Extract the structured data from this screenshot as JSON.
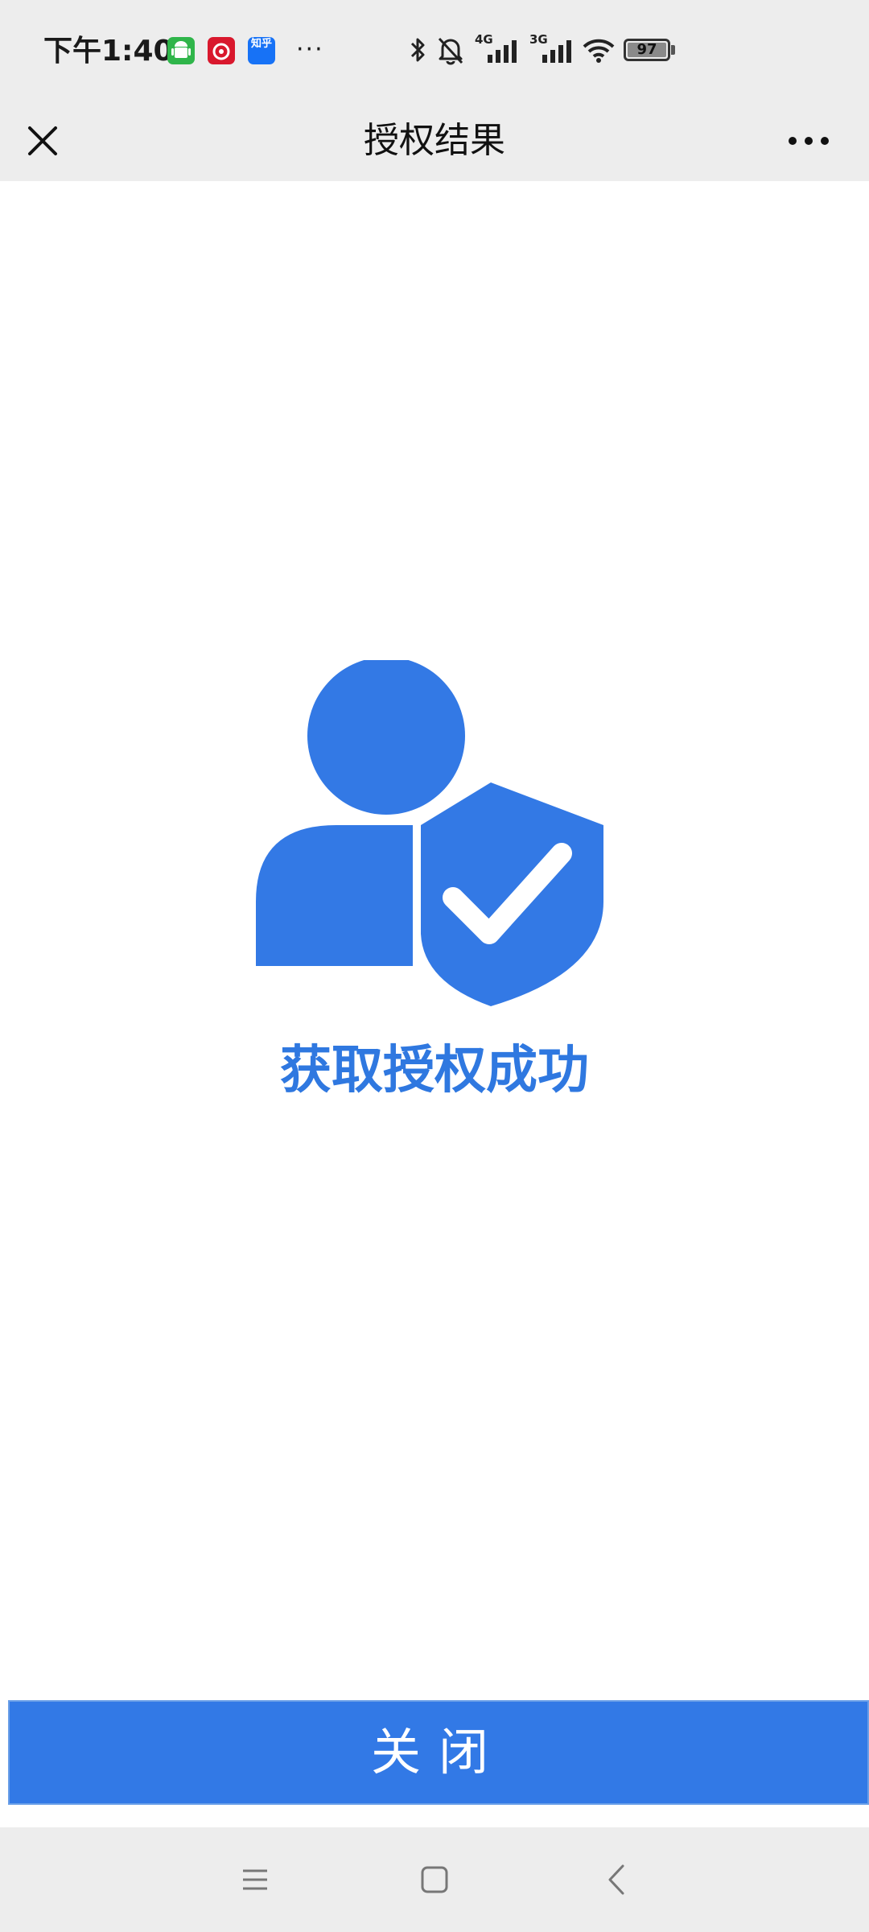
{
  "status_bar": {
    "time": "下午1:40",
    "app_icons": [
      {
        "name": "android-app-icon",
        "color": "#2fb54a",
        "label": ""
      },
      {
        "name": "netease-music-icon",
        "color": "#d9182d",
        "label": ""
      },
      {
        "name": "zhihu-icon",
        "color": "#1772f6",
        "label": "知乎"
      }
    ],
    "more_notifications": "···",
    "network_4g": "4G",
    "network_3g": "3G",
    "battery": "97"
  },
  "nav": {
    "title": "授权结果",
    "close_icon": "close-icon",
    "more_icon": "more-dots-icon"
  },
  "main": {
    "result_text": "获取授权成功",
    "illustration_icon": "user-shield-check-icon",
    "accent_color": "#2f78e0"
  },
  "footer": {
    "close_label": "关闭",
    "button_color": "#3279e6"
  },
  "system_nav": {
    "menu_icon": "menu-icon",
    "home_icon": "home-icon",
    "back_icon": "back-icon"
  }
}
